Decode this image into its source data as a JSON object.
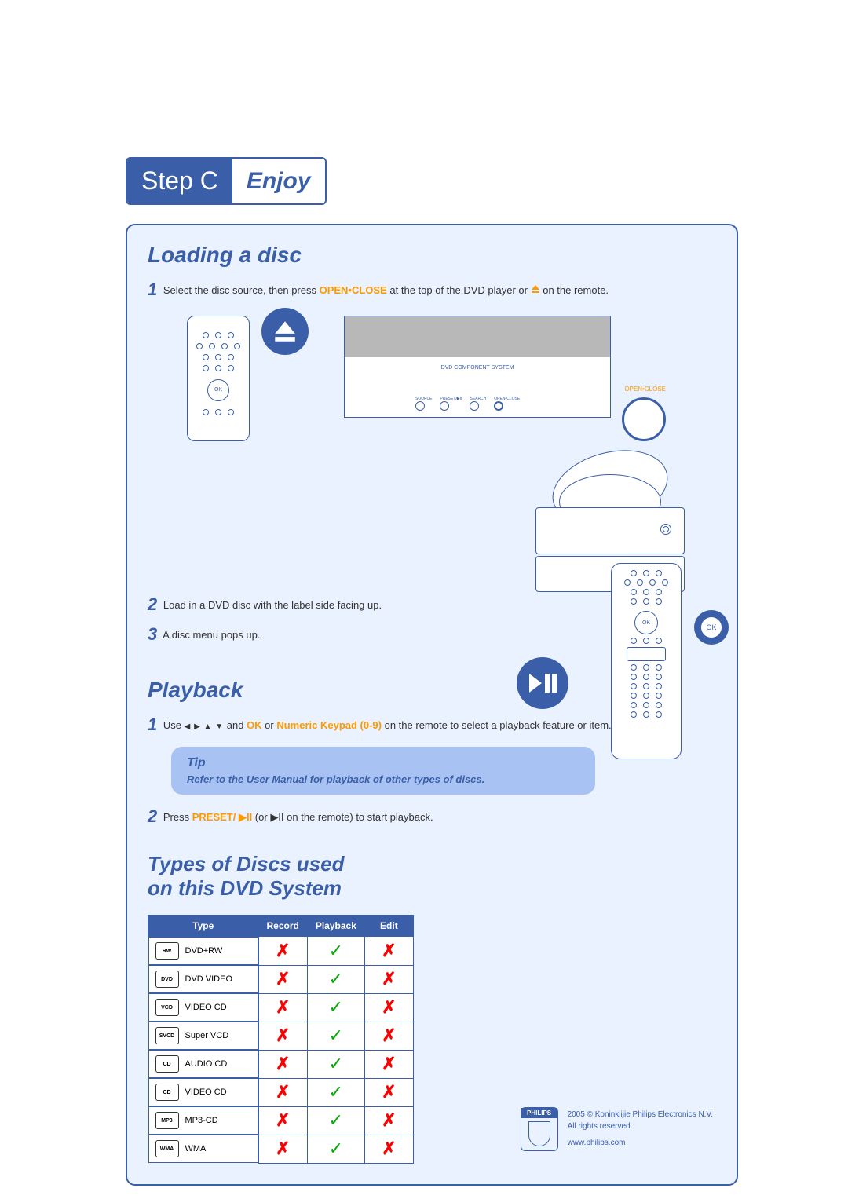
{
  "banner": {
    "step": "Step C",
    "title": "Enjoy"
  },
  "section_loading": {
    "title": "Loading a disc",
    "step1_a": "Select the disc source, then press ",
    "step1_kw": "OPEN•CLOSE",
    "step1_b": " at the top of the DVD player or ",
    "step1_c": " on the remote.",
    "step2": "Load in a DVD disc with the label side facing up.",
    "step3": "A disc menu pops up.",
    "device_label": "DVD COMPONENT SYSTEM",
    "open_label": "OPEN•CLOSE",
    "ok_label": "OK"
  },
  "section_playback": {
    "title": "Playback",
    "step1_a": "Use ",
    "step1_b": " and ",
    "step1_kw1": "OK",
    "step1_c": " or ",
    "step1_kw2": "Numeric Keypad (0-9)",
    "step1_d": " on the remote to select a playback feature or item.",
    "tip_title": "Tip",
    "tip_text": "Refer to the User Manual for playback of other types of discs.",
    "step2_a": "Press ",
    "step2_kw": "PRESET/",
    "step2_b": " (or ",
    "step2_c": " on the remote) to start playback.",
    "ok_label": "OK"
  },
  "section_types": {
    "title_l1": "Types of Discs used",
    "title_l2": "on this DVD System",
    "headers": {
      "type": "Type",
      "record": "Record",
      "playback": "Playback",
      "edit": "Edit"
    },
    "rows": [
      {
        "logo": "RW",
        "name": "DVD+RW",
        "record": false,
        "playback": true,
        "edit": false
      },
      {
        "logo": "DVD",
        "name": "DVD VIDEO",
        "record": false,
        "playback": true,
        "edit": false
      },
      {
        "logo": "VCD",
        "name": "VIDEO CD",
        "record": false,
        "playback": true,
        "edit": false
      },
      {
        "logo": "SVCD",
        "name": "Super VCD",
        "record": false,
        "playback": true,
        "edit": false
      },
      {
        "logo": "CD",
        "name": "AUDIO CD",
        "record": false,
        "playback": true,
        "edit": false
      },
      {
        "logo": "CD",
        "name": "VIDEO CD",
        "record": false,
        "playback": true,
        "edit": false
      },
      {
        "logo": "MP3",
        "name": "MP3-CD",
        "record": false,
        "playback": true,
        "edit": false
      },
      {
        "logo": "WMA",
        "name": "WMA",
        "record": false,
        "playback": true,
        "edit": false
      }
    ]
  },
  "footer": {
    "brand": "PHILIPS",
    "copyright": "2005 © Koninklijie Philips Electronics N.V.",
    "rights": "All rights reserved.",
    "url": "www.philips.com"
  }
}
